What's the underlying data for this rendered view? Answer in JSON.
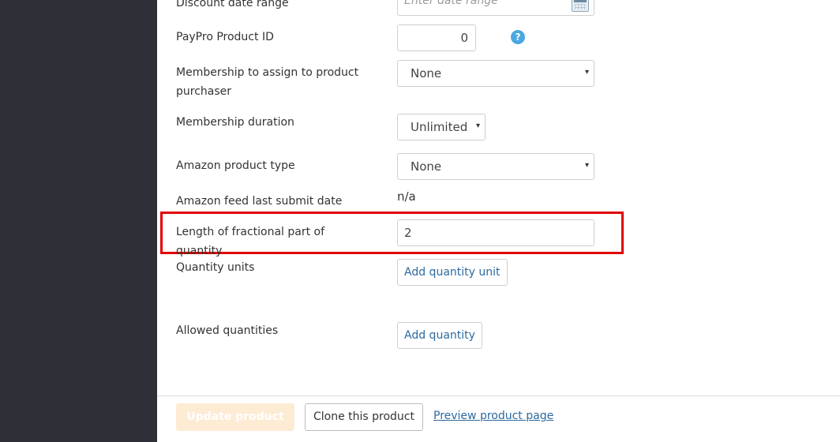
{
  "fields": {
    "discount_date_range": {
      "label": "Discount date range",
      "placeholder": "Enter date range"
    },
    "paypro_product_id": {
      "label": "PayPro Product ID",
      "value": "0",
      "help_icon": "?"
    },
    "membership_assign": {
      "label": "Membership to assign to product purchaser",
      "selected": "None"
    },
    "membership_duration": {
      "label": "Membership duration",
      "selected": "Unlimited"
    },
    "amazon_product_type": {
      "label": "Amazon product type",
      "selected": "None"
    },
    "amazon_feed_last_submit": {
      "label": "Amazon feed last submit date",
      "value": "n/a"
    },
    "fractional_length": {
      "label": "Length of fractional part of quantity",
      "value": "2"
    },
    "quantity_units": {
      "label": "Quantity units",
      "button": "Add quantity unit"
    },
    "allowed_quantities": {
      "label": "Allowed quantities",
      "button": "Add quantity"
    }
  },
  "footer": {
    "update_label": "Update product",
    "clone_label": "Clone this product",
    "preview_label": "Preview product page"
  },
  "icons": {
    "select_arrow": "▾",
    "calendar": "calendar-icon",
    "help": "help-icon"
  },
  "colors": {
    "sidebar": "#2f2f38",
    "highlight": "#e00000",
    "link": "#2c6aa0",
    "help_icon": "#4aa8e0",
    "update_button_disabled": "#fdebd4"
  }
}
